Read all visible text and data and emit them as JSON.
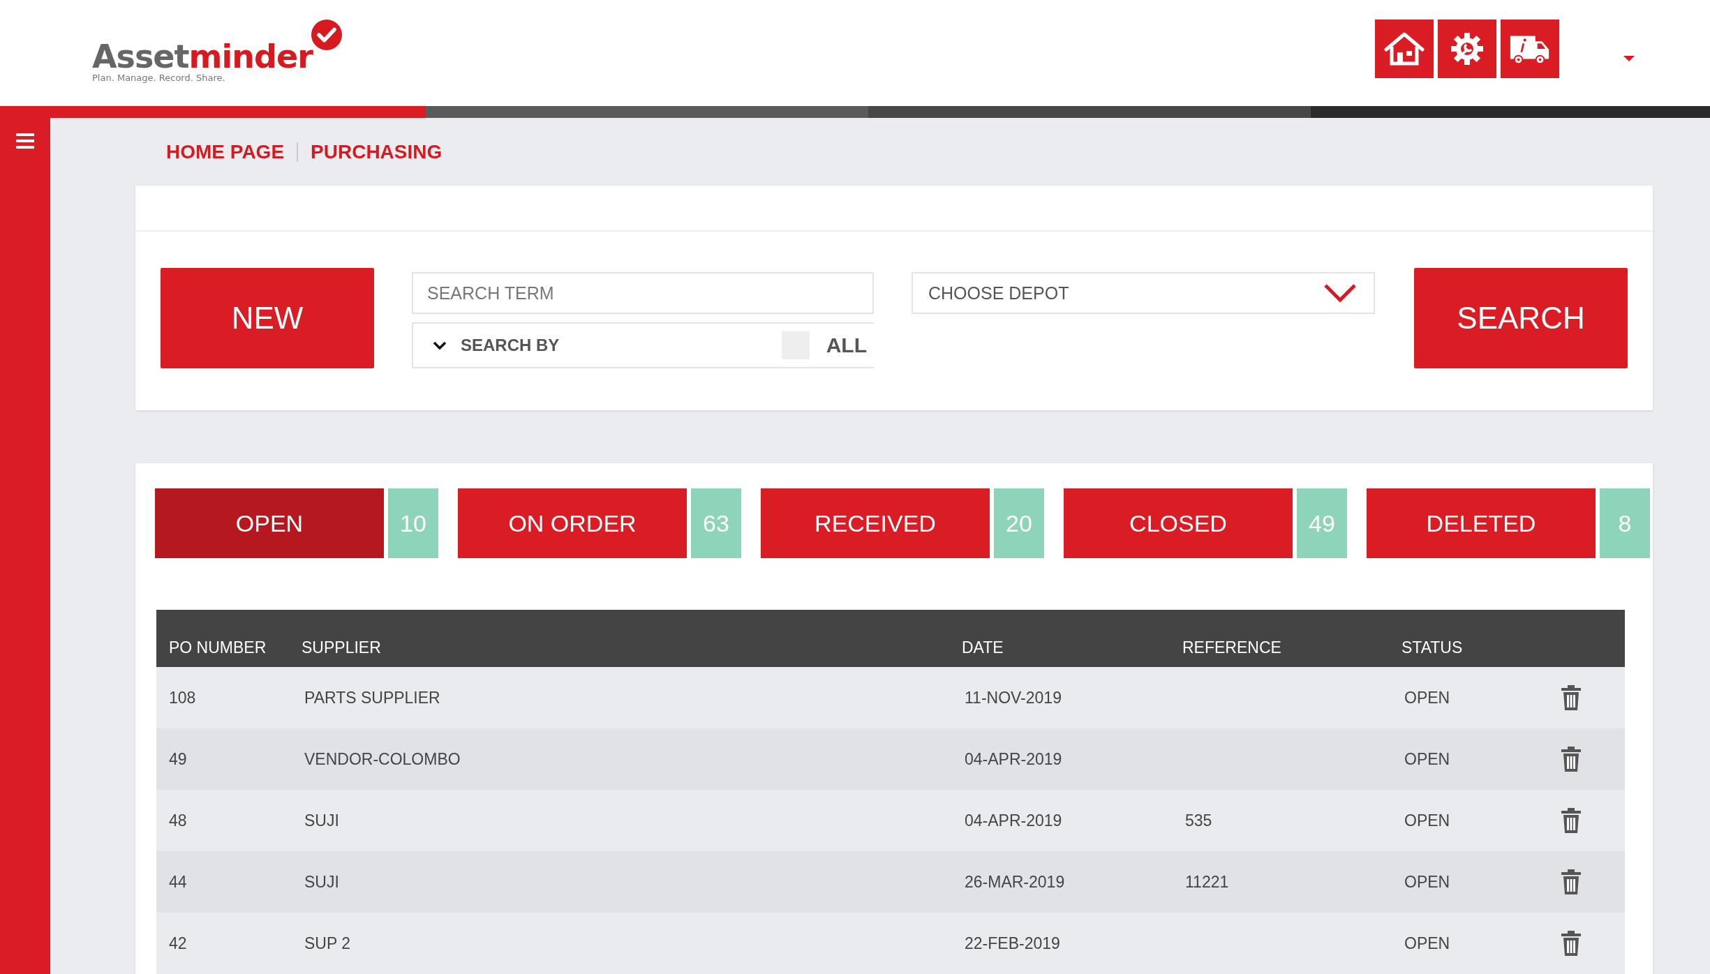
{
  "logo": {
    "name_dark": "Asset",
    "name_red": "minder",
    "tagline": "Plan. Manage. Record. Share."
  },
  "breadcrumb": [
    "HOME PAGE",
    "PURCHASING"
  ],
  "toolbar": {
    "new_button": "NEW",
    "search": {
      "placeholder": "SEARCH TERM"
    },
    "search_by": "SEARCH BY",
    "all": {
      "label": "ALL",
      "checked": false
    },
    "depot": {
      "placeholder": "CHOOSE DEPOT"
    },
    "search_button": "SEARCH"
  },
  "tabs": [
    {
      "label": "OPEN",
      "count": "10",
      "selected": true
    },
    {
      "label": "ON ORDER",
      "count": "63",
      "selected": false
    },
    {
      "label": "RECEIVED",
      "count": "20",
      "selected": false
    },
    {
      "label": "CLOSED",
      "count": "49",
      "selected": false
    },
    {
      "label": "DELETED",
      "count": "8",
      "selected": false
    }
  ],
  "table": {
    "columns": [
      "PO NUMBER",
      "SUPPLIER",
      "DATE",
      "REFERENCE",
      "STATUS"
    ],
    "rows": [
      [
        "108",
        "PARTS SUPPLIER",
        "11-NOV-2019",
        "",
        "OPEN"
      ],
      [
        "49",
        "VENDOR-COLOMBO",
        "04-APR-2019",
        "",
        "OPEN"
      ],
      [
        "48",
        "SUJI",
        "04-APR-2019",
        "535",
        "OPEN"
      ],
      [
        "44",
        "SUJI",
        "26-MAR-2019",
        "11221",
        "OPEN"
      ],
      [
        "42",
        "SUP 2",
        "22-FEB-2019",
        "",
        "OPEN"
      ]
    ]
  }
}
